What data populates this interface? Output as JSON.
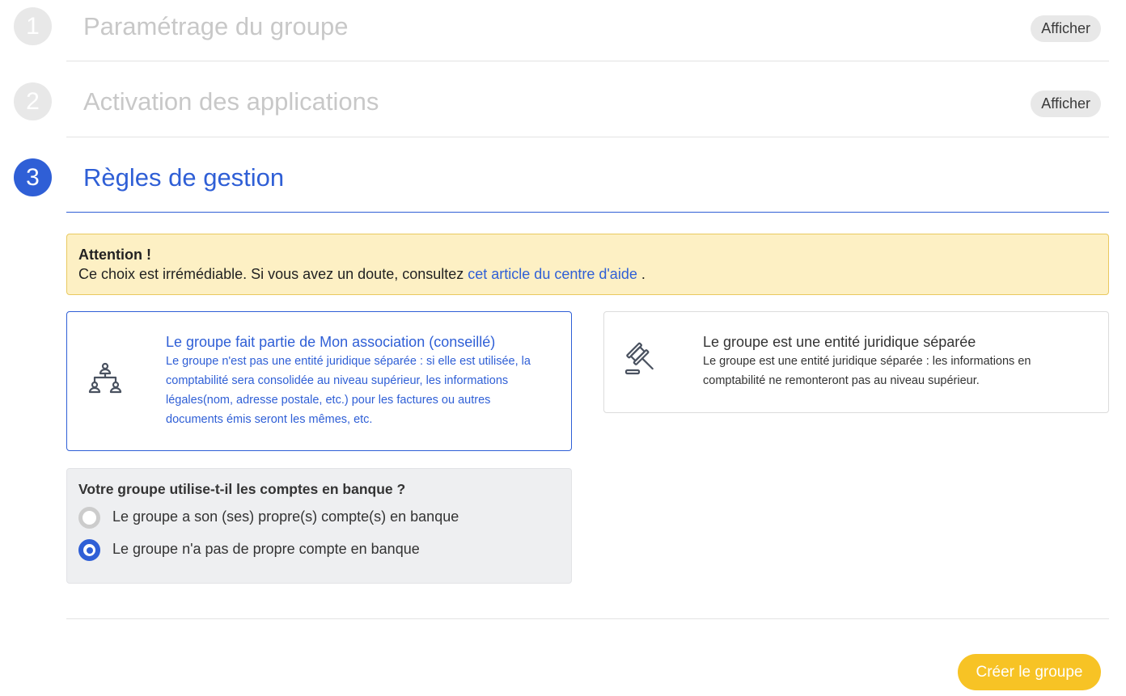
{
  "steps": [
    {
      "number": "1",
      "title": "Paramétrage du groupe",
      "action": "Afficher"
    },
    {
      "number": "2",
      "title": "Activation des applications",
      "action": "Afficher"
    },
    {
      "number": "3",
      "title": "Règles de gestion"
    }
  ],
  "warning": {
    "title": "Attention !",
    "text_before": "Ce choix est irrémédiable. Si vous avez un doute, consultez",
    "link_text": "cet article du centre d'aide",
    "text_after": "."
  },
  "options": [
    {
      "icon": "org-chart-icon",
      "title": "Le groupe fait partie de Mon association (conseillé)",
      "description": "Le groupe n'est pas une entité juridique séparée : si elle est utilisée, la comptabilité sera consolidée au niveau supérieur, les informations légales(nom, adresse postale, etc.) pour les factures ou autres documents émis seront les mêmes, etc.",
      "selected": true
    },
    {
      "icon": "gavel-icon",
      "title": "Le groupe est une entité juridique séparée",
      "description": "Le groupe est une entité juridique séparée : les informations en comptabilité ne remonteront pas au niveau supérieur.",
      "selected": false
    }
  ],
  "bank": {
    "question": "Votre groupe utilise-t-il les comptes en banque ?",
    "choices": [
      {
        "label": "Le groupe a son (ses) propre(s) compte(s) en banque",
        "checked": false
      },
      {
        "label": "Le groupe n'a pas de propre compte en banque",
        "checked": true
      }
    ]
  },
  "create_button": "Créer le groupe",
  "colors": {
    "accent": "#2f5fd6",
    "warning_bg": "#fdf0c4",
    "cta": "#f7c325",
    "inactive": "#c8c8c8"
  }
}
